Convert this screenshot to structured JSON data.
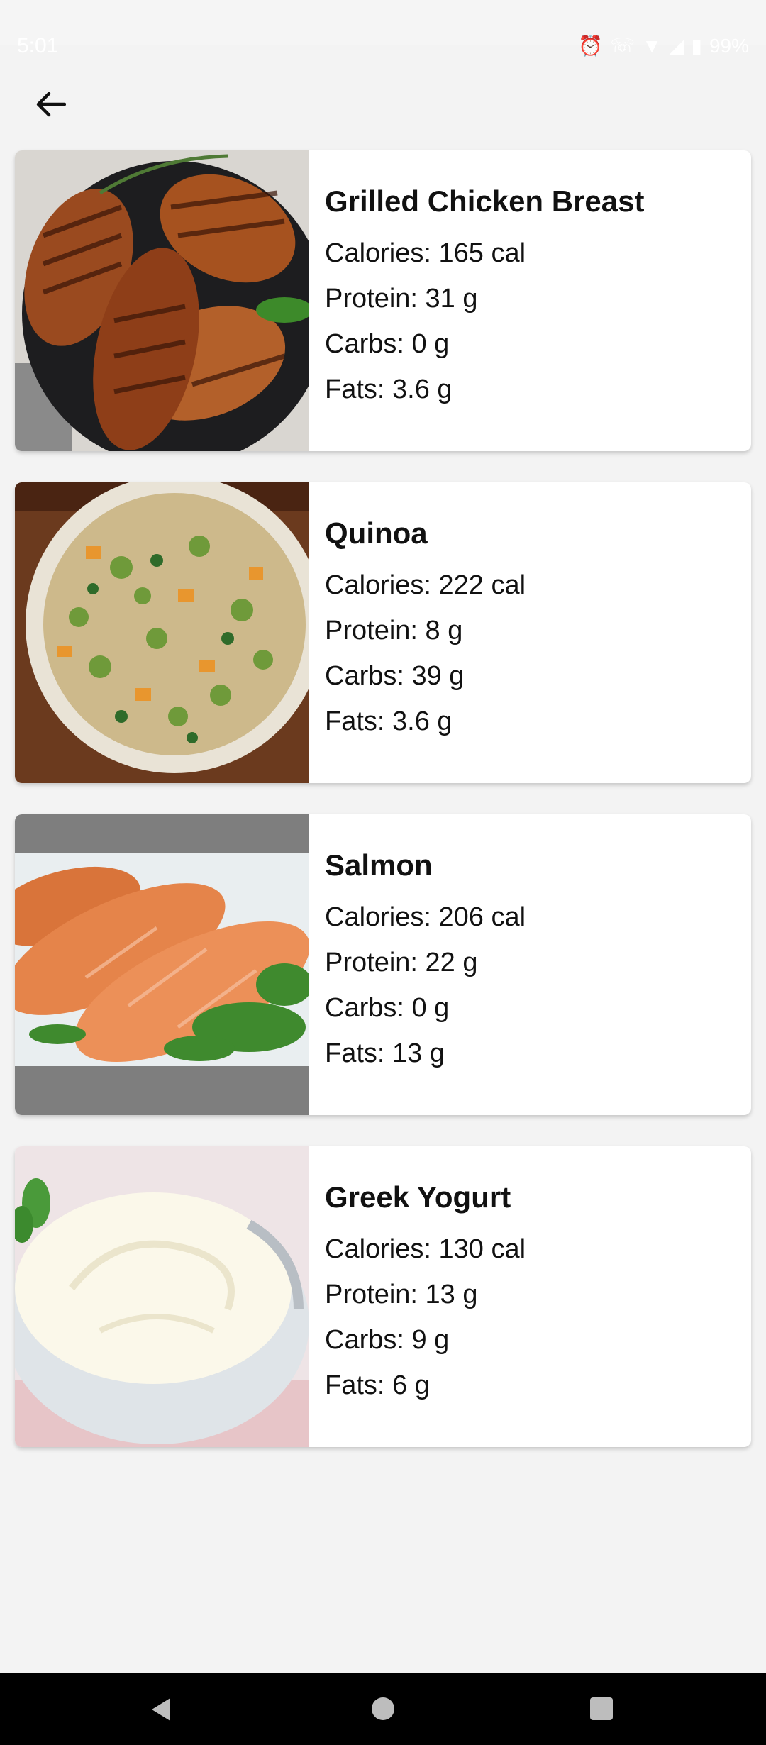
{
  "status_bar": {
    "time": "5:01",
    "battery": "99%",
    "icons": [
      "alarm-icon",
      "wifi-call-icon",
      "wifi-icon",
      "signal-icon",
      "battery-icon"
    ]
  },
  "app_bar": {
    "back_icon": "arrow-left-icon"
  },
  "foods": [
    {
      "name": "Grilled Chicken Breast",
      "calories": "Calories: 165 cal",
      "protein": "Protein: 31 g",
      "carbs": "Carbs: 0 g",
      "fats": "Fats: 3.6 g"
    },
    {
      "name": "Quinoa",
      "calories": "Calories: 222 cal",
      "protein": "Protein: 8 g",
      "carbs": "Carbs: 39 g",
      "fats": "Fats: 3.6 g"
    },
    {
      "name": "Salmon",
      "calories": "Calories: 206 cal",
      "protein": "Protein: 22 g",
      "carbs": "Carbs: 0 g",
      "fats": "Fats: 13 g"
    },
    {
      "name": "Greek Yogurt",
      "calories": "Calories: 130 cal",
      "protein": "Protein: 13 g",
      "carbs": "Carbs: 9 g",
      "fats": "Fats: 6 g"
    }
  ],
  "colors": {
    "background": "#f3f3f3",
    "card": "#ffffff",
    "text": "#111111",
    "nav_bar": "#000000"
  }
}
